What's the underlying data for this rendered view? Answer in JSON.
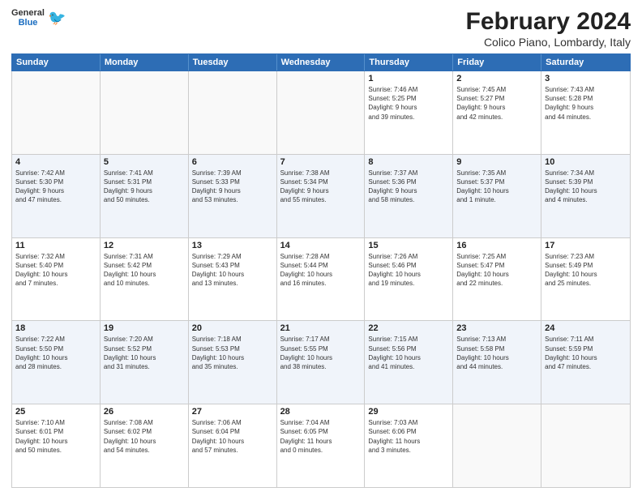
{
  "header": {
    "logo": {
      "general": "General",
      "blue": "Blue",
      "bird": "🐦"
    },
    "title": "February 2024",
    "subtitle": "Colico Piano, Lombardy, Italy"
  },
  "calendar": {
    "headers": [
      "Sunday",
      "Monday",
      "Tuesday",
      "Wednesday",
      "Thursday",
      "Friday",
      "Saturday"
    ],
    "weeks": [
      [
        {
          "day": "",
          "info": ""
        },
        {
          "day": "",
          "info": ""
        },
        {
          "day": "",
          "info": ""
        },
        {
          "day": "",
          "info": ""
        },
        {
          "day": "1",
          "info": "Sunrise: 7:46 AM\nSunset: 5:25 PM\nDaylight: 9 hours\nand 39 minutes."
        },
        {
          "day": "2",
          "info": "Sunrise: 7:45 AM\nSunset: 5:27 PM\nDaylight: 9 hours\nand 42 minutes."
        },
        {
          "day": "3",
          "info": "Sunrise: 7:43 AM\nSunset: 5:28 PM\nDaylight: 9 hours\nand 44 minutes."
        }
      ],
      [
        {
          "day": "4",
          "info": "Sunrise: 7:42 AM\nSunset: 5:30 PM\nDaylight: 9 hours\nand 47 minutes."
        },
        {
          "day": "5",
          "info": "Sunrise: 7:41 AM\nSunset: 5:31 PM\nDaylight: 9 hours\nand 50 minutes."
        },
        {
          "day": "6",
          "info": "Sunrise: 7:39 AM\nSunset: 5:33 PM\nDaylight: 9 hours\nand 53 minutes."
        },
        {
          "day": "7",
          "info": "Sunrise: 7:38 AM\nSunset: 5:34 PM\nDaylight: 9 hours\nand 55 minutes."
        },
        {
          "day": "8",
          "info": "Sunrise: 7:37 AM\nSunset: 5:36 PM\nDaylight: 9 hours\nand 58 minutes."
        },
        {
          "day": "9",
          "info": "Sunrise: 7:35 AM\nSunset: 5:37 PM\nDaylight: 10 hours\nand 1 minute."
        },
        {
          "day": "10",
          "info": "Sunrise: 7:34 AM\nSunset: 5:39 PM\nDaylight: 10 hours\nand 4 minutes."
        }
      ],
      [
        {
          "day": "11",
          "info": "Sunrise: 7:32 AM\nSunset: 5:40 PM\nDaylight: 10 hours\nand 7 minutes."
        },
        {
          "day": "12",
          "info": "Sunrise: 7:31 AM\nSunset: 5:42 PM\nDaylight: 10 hours\nand 10 minutes."
        },
        {
          "day": "13",
          "info": "Sunrise: 7:29 AM\nSunset: 5:43 PM\nDaylight: 10 hours\nand 13 minutes."
        },
        {
          "day": "14",
          "info": "Sunrise: 7:28 AM\nSunset: 5:44 PM\nDaylight: 10 hours\nand 16 minutes."
        },
        {
          "day": "15",
          "info": "Sunrise: 7:26 AM\nSunset: 5:46 PM\nDaylight: 10 hours\nand 19 minutes."
        },
        {
          "day": "16",
          "info": "Sunrise: 7:25 AM\nSunset: 5:47 PM\nDaylight: 10 hours\nand 22 minutes."
        },
        {
          "day": "17",
          "info": "Sunrise: 7:23 AM\nSunset: 5:49 PM\nDaylight: 10 hours\nand 25 minutes."
        }
      ],
      [
        {
          "day": "18",
          "info": "Sunrise: 7:22 AM\nSunset: 5:50 PM\nDaylight: 10 hours\nand 28 minutes."
        },
        {
          "day": "19",
          "info": "Sunrise: 7:20 AM\nSunset: 5:52 PM\nDaylight: 10 hours\nand 31 minutes."
        },
        {
          "day": "20",
          "info": "Sunrise: 7:18 AM\nSunset: 5:53 PM\nDaylight: 10 hours\nand 35 minutes."
        },
        {
          "day": "21",
          "info": "Sunrise: 7:17 AM\nSunset: 5:55 PM\nDaylight: 10 hours\nand 38 minutes."
        },
        {
          "day": "22",
          "info": "Sunrise: 7:15 AM\nSunset: 5:56 PM\nDaylight: 10 hours\nand 41 minutes."
        },
        {
          "day": "23",
          "info": "Sunrise: 7:13 AM\nSunset: 5:58 PM\nDaylight: 10 hours\nand 44 minutes."
        },
        {
          "day": "24",
          "info": "Sunrise: 7:11 AM\nSunset: 5:59 PM\nDaylight: 10 hours\nand 47 minutes."
        }
      ],
      [
        {
          "day": "25",
          "info": "Sunrise: 7:10 AM\nSunset: 6:01 PM\nDaylight: 10 hours\nand 50 minutes."
        },
        {
          "day": "26",
          "info": "Sunrise: 7:08 AM\nSunset: 6:02 PM\nDaylight: 10 hours\nand 54 minutes."
        },
        {
          "day": "27",
          "info": "Sunrise: 7:06 AM\nSunset: 6:04 PM\nDaylight: 10 hours\nand 57 minutes."
        },
        {
          "day": "28",
          "info": "Sunrise: 7:04 AM\nSunset: 6:05 PM\nDaylight: 11 hours\nand 0 minutes."
        },
        {
          "day": "29",
          "info": "Sunrise: 7:03 AM\nSunset: 6:06 PM\nDaylight: 11 hours\nand 3 minutes."
        },
        {
          "day": "",
          "info": ""
        },
        {
          "day": "",
          "info": ""
        }
      ]
    ]
  }
}
